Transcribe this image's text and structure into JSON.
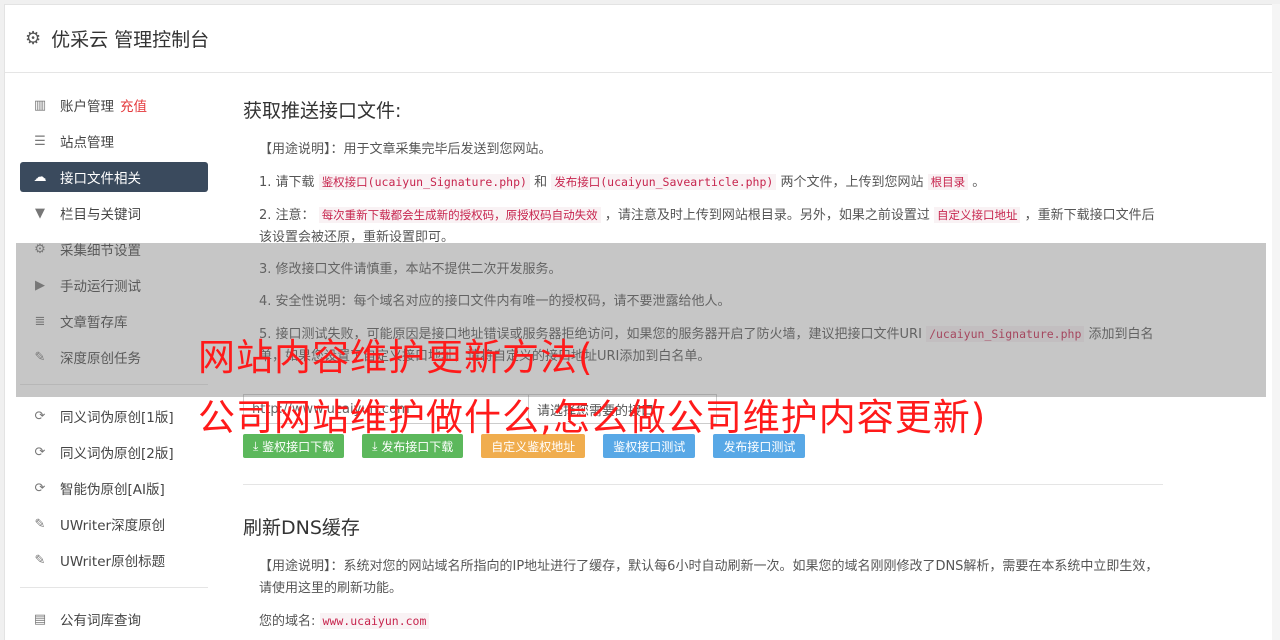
{
  "header": {
    "title": "优采云 管理控制台",
    "icon": "gear-icon"
  },
  "sidebar": {
    "items": [
      {
        "label": "账户管理",
        "extra": "充值",
        "icon": "bar-chart-icon",
        "active": false
      },
      {
        "label": "站点管理",
        "icon": "server-icon",
        "active": false
      },
      {
        "label": "接口文件相关",
        "icon": "cloud-upload-icon",
        "active": true
      },
      {
        "label": "栏目与关键词",
        "icon": "filter-icon",
        "active": false
      },
      {
        "label": "采集细节设置",
        "icon": "gears-icon",
        "active": false
      },
      {
        "label": "手动运行测试",
        "icon": "play-circle-icon",
        "active": false
      },
      {
        "label": "文章暂存库",
        "icon": "database-icon",
        "active": false
      },
      {
        "label": "深度原创任务",
        "icon": "edit-icon",
        "active": false
      }
    ],
    "items2": [
      {
        "label": "同义词伪原创[1版]",
        "icon": "refresh-icon"
      },
      {
        "label": "同义词伪原创[2版]",
        "icon": "refresh-icon"
      },
      {
        "label": "智能伪原创[AI版]",
        "icon": "refresh-icon"
      },
      {
        "label": "UWriter深度原创",
        "icon": "edit-icon"
      },
      {
        "label": "UWriter原创标题",
        "icon": "edit-icon"
      }
    ],
    "items3": [
      {
        "label": "公有词库查询",
        "icon": "book-icon"
      }
    ]
  },
  "section1": {
    "title": "获取推送接口文件:",
    "usage": "【用途说明】：用于文章采集完毕后发送到您网站。",
    "p1_a": "1. 请下载",
    "p1_code1": "鉴权接口(ucaiyun_Signature.php)",
    "p1_b": "和",
    "p1_code2": "发布接口(ucaiyun_Savearticle.php)",
    "p1_c": "两个文件，上传到您网站",
    "p1_code3": "根目录",
    "p1_d": "。",
    "p2_a": "2. 注意：",
    "p2_code1": "每次重新下载都会生成新的授权码，原授权码自动失效",
    "p2_b": "，请注意及时上传到网站根目录。另外，如果之前设置过",
    "p2_code2": "自定义接口地址",
    "p2_c": "，重新下载接口文件后该设置会被还原，重新设置即可。",
    "p3": "3. 修改接口文件请慎重，本站不提供二次开发服务。",
    "p4": "4. 安全性说明：每个域名对应的接口文件内有唯一的授权码，请不要泄露给他人。",
    "p5_a": "5. 接口测试失败，可能原因是接口地址错误或服务器拒绝访问，如果您的服务器开启了防火墙，建议把接口文件URI",
    "p5_code": "/ucaiyun_Signature.php",
    "p5_b": "添加到白名单，如果您设置了自定义接口地址，请将自定义的接口地址URI添加到白名单。",
    "url_value": "http://www.ucaiyun.com",
    "select_value": "请选择您需要的接口",
    "buttons": {
      "auth_download": "鉴权接口下载",
      "publish_download": "发布接口下载",
      "custom_auth": "自定义鉴权地址",
      "auth_test": "鉴权接口测试",
      "publish_test": "发布接口测试"
    }
  },
  "section2": {
    "title": "刷新DNS缓存",
    "usage": "【用途说明】：系统对您的网站域名所指向的IP地址进行了缓存，默认每6小时自动刷新一次。如果您的域名刚刚修改了DNS解析，需要在本系统中立即生效，请使用这里的刷新功能。",
    "domain_label": "您的域名:",
    "domain_value": "www.ucaiyun.com"
  },
  "watermark": {
    "line1": "网站内容维护更新方法(",
    "line2": "公司网站维护做什么,怎么做公司维护内容更新)"
  }
}
